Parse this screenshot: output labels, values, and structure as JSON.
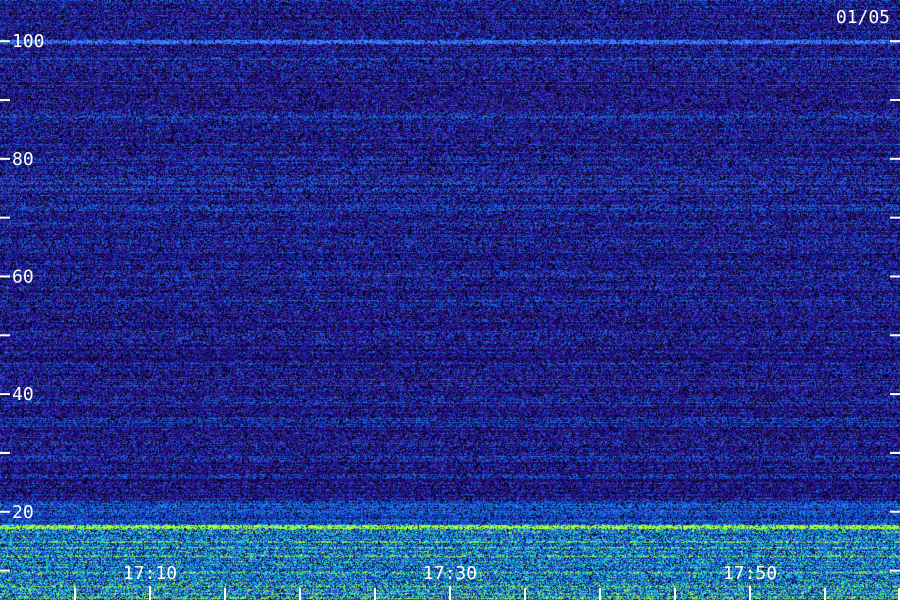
{
  "chart_data": {
    "type": "heatmap",
    "date_label": "01/05",
    "y_ticks": [
      {
        "value": 100,
        "label": "100"
      },
      {
        "value": 80,
        "label": "80"
      },
      {
        "value": 60,
        "label": "60"
      },
      {
        "value": 40,
        "label": "40"
      },
      {
        "value": 20,
        "label": "20"
      }
    ],
    "y_minor_ticks": [
      90,
      70,
      50,
      30,
      10
    ],
    "ylim": [
      5,
      107
    ],
    "x_ticks": [
      {
        "value": "17:10",
        "label": "17:10"
      },
      {
        "value": "17:30",
        "label": "17:30"
      },
      {
        "value": "17:50",
        "label": "17:50"
      }
    ],
    "x_minor_ticks": [
      "17:05",
      "17:15",
      "17:20",
      "17:25",
      "17:35",
      "17:40",
      "17:45",
      "17:55",
      "18:00"
    ],
    "xlim": [
      "17:00",
      "18:00"
    ],
    "intensity_bands": [
      {
        "from": 5,
        "to": 18,
        "level": "high"
      },
      {
        "from": 18,
        "to": 22,
        "level": "medium"
      },
      {
        "from": 22,
        "to": 107,
        "level": "low"
      }
    ],
    "hot_lines": [
      17.5,
      100
    ],
    "colors": {
      "background": "#000000",
      "low": "#2a12a0",
      "mid": "#2540e0",
      "high": "#20d0d0",
      "peak": "#b0ff40",
      "labels": "#ffffff"
    }
  }
}
